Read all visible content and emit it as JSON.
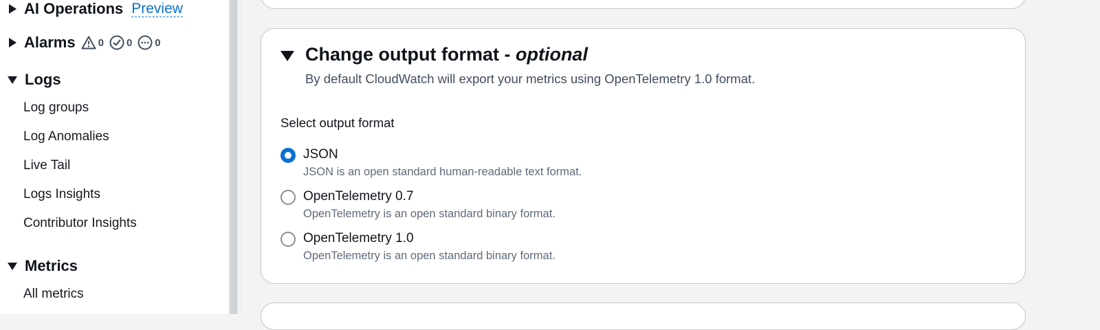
{
  "sidebar": {
    "ai_operations": {
      "label": "AI Operations",
      "badge": "Preview"
    },
    "alarms": {
      "label": "Alarms",
      "in_alarm_count": "0",
      "ok_count": "0",
      "insufficient_count": "0"
    },
    "logs": {
      "label": "Logs",
      "items": [
        "Log groups",
        "Log Anomalies",
        "Live Tail",
        "Logs Insights",
        "Contributor Insights"
      ]
    },
    "metrics": {
      "label": "Metrics",
      "items": [
        "All metrics"
      ]
    }
  },
  "output_format_section": {
    "title": "Change output format - ",
    "title_suffix": "optional",
    "description": "By default CloudWatch will export your metrics using OpenTelemetry 1.0 format.",
    "field_label": "Select output format",
    "options": [
      {
        "label": "JSON",
        "description": "JSON is an open standard human-readable text format.",
        "selected": true
      },
      {
        "label": "OpenTelemetry 0.7",
        "description": "OpenTelemetry is an open standard binary format.",
        "selected": false
      },
      {
        "label": "OpenTelemetry 1.0",
        "description": "OpenTelemetry is an open standard binary format.",
        "selected": false
      }
    ]
  },
  "colors": {
    "accent": "#0972d3",
    "text": "#0f141a",
    "secondary_text": "#5f6b7a",
    "card_border": "#c6c6cd"
  }
}
